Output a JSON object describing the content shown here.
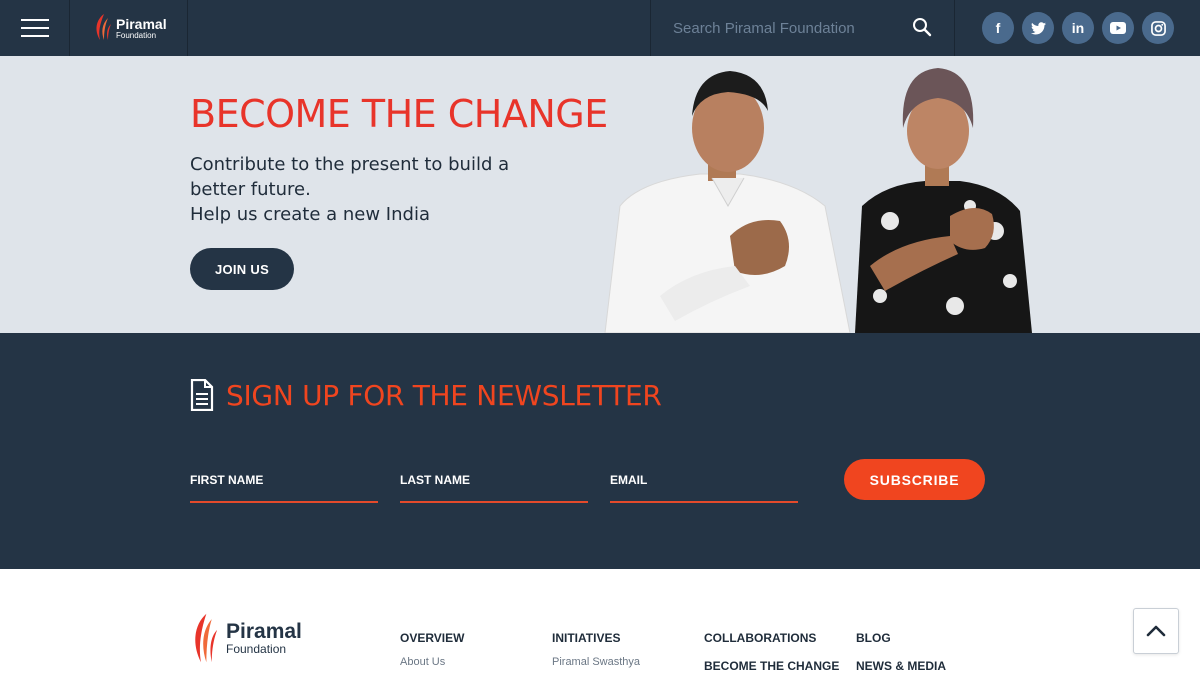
{
  "header": {
    "logo_name": "Piramal",
    "logo_sub": "Foundation",
    "search_placeholder": "Search Piramal Foundation",
    "socials": [
      {
        "icon": "facebook-icon",
        "glyph": "f"
      },
      {
        "icon": "twitter-icon",
        "glyph": "t"
      },
      {
        "icon": "linkedin-icon",
        "glyph": "in"
      },
      {
        "icon": "youtube-icon",
        "glyph": "▶"
      },
      {
        "icon": "instagram-icon",
        "glyph": "◎"
      }
    ]
  },
  "hero": {
    "title": "BECOME THE CHANGE",
    "line1": "Contribute to the present to build a better future.",
    "line2": "Help us create a new India",
    "button": "JOIN US"
  },
  "newsletter": {
    "title": "SIGN UP FOR THE NEWSLETTER",
    "first_name": "FIRST NAME",
    "last_name": "LAST NAME",
    "email": "EMAIL",
    "subscribe": "SUBSCRIBE"
  },
  "footer": {
    "logo_name": "Piramal",
    "logo_sub": "Foundation",
    "overview": "OVERVIEW",
    "about": "About Us",
    "initiatives": "INITIATIVES",
    "swasthya": "Piramal Swasthya",
    "collaborations": "COLLABORATIONS",
    "become": "BECOME THE CHANGE",
    "blog": "BLOG",
    "news": "NEWS & MEDIA"
  },
  "colors": {
    "navy": "#243445",
    "accent": "#f0451f",
    "hero_red": "#e8342a"
  }
}
